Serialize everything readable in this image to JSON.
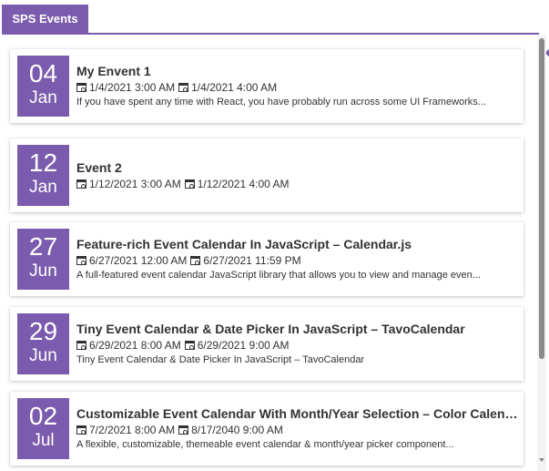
{
  "tab": {
    "label": "SPS Events"
  },
  "accent_color": "#7b5bad",
  "icons": {
    "start": "calendar-clock-icon",
    "end": "calendar-clock-icon"
  },
  "events": [
    {
      "day": "04",
      "month": "Jan",
      "title": "My Envent 1",
      "start": "1/4/2021 3:00 AM",
      "end": "1/4/2021 4:00 AM",
      "description": "If you have spent any time with React, you have probably run across some UI Frameworks..."
    },
    {
      "day": "12",
      "month": "Jan",
      "title": "Event 2",
      "start": "1/12/2021 3:00 AM",
      "end": "1/12/2021 4:00 AM",
      "description": ""
    },
    {
      "day": "27",
      "month": "Jun",
      "title": "Feature-rich Event Calendar In JavaScript – Calendar.js",
      "start": "6/27/2021 12:00 AM",
      "end": "6/27/2021 11:59 PM",
      "description": "A full-featured event calendar JavaScript library that allows you to view and manage even..."
    },
    {
      "day": "29",
      "month": "Jun",
      "title": "Tiny Event Calendar & Date Picker In JavaScript – TavoCalendar",
      "start": "6/29/2021 8:00 AM",
      "end": "6/29/2021 9:00 AM",
      "description": "Tiny Event Calendar & Date Picker In JavaScript – TavoCalendar"
    },
    {
      "day": "02",
      "month": "Jul",
      "title": "Customizable Event Calendar With Month/Year Selection – Color Calendar",
      "start": "7/2/2021 8:00 AM",
      "end": "8/17/2040 9:00 AM",
      "description": "A flexible, customizable, themeable event calendar & month/year picker component..."
    }
  ]
}
